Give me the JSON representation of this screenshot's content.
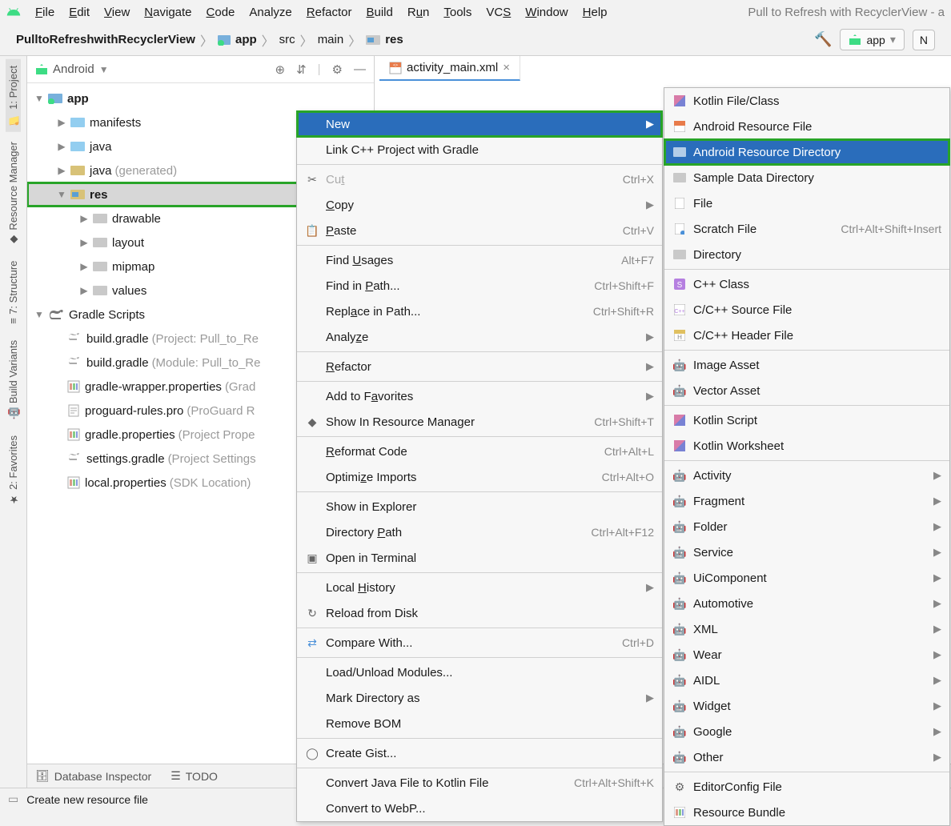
{
  "window": {
    "title_right": "Pull to Refresh with RecyclerView - a"
  },
  "menu": {
    "file": "File",
    "edit": "Edit",
    "view": "View",
    "navigate": "Navigate",
    "code": "Code",
    "analyze": "Analyze",
    "refactor": "Refactor",
    "build": "Build",
    "run": "Run",
    "tools": "Tools",
    "vcs": "VCS",
    "window": "Window",
    "help": "Help"
  },
  "breadcrumb": [
    "PulltoRefreshwithRecyclerView",
    "app",
    "src",
    "main",
    "res"
  ],
  "run_config": {
    "app": "app",
    "new": "N"
  },
  "side_tools": {
    "project": "1: Project",
    "resource_manager": "Resource Manager",
    "structure": "7: Structure",
    "build_variants": "Build Variants",
    "favorites": "2: Favorites"
  },
  "project_header": {
    "title": "Android"
  },
  "tree": {
    "app": "app",
    "manifests": "manifests",
    "java": "java",
    "java_gen": "java",
    "java_gen_suffix": " (generated)",
    "res": "res",
    "drawable": "drawable",
    "layout": "layout",
    "mipmap": "mipmap",
    "values": "values",
    "gradle_scripts": "Gradle Scripts",
    "build_gradle_proj": "build.gradle",
    "build_gradle_proj_suffix": " (Project: Pull_to_Re",
    "build_gradle_mod": "build.gradle",
    "build_gradle_mod_suffix": " (Module: Pull_to_Re",
    "gradle_wrapper": "gradle-wrapper.properties",
    "gradle_wrapper_suffix": " (Grad",
    "proguard": "proguard-rules.pro",
    "proguard_suffix": " (ProGuard R",
    "gradle_props": "gradle.properties",
    "gradle_props_suffix": " (Project Prope",
    "settings_gradle": "settings.gradle",
    "settings_gradle_suffix": " (Project Settings",
    "local_props": "local.properties",
    "local_props_suffix": " (SDK Location)"
  },
  "editor": {
    "tab": "activity_main.xml"
  },
  "context_menu": {
    "new": "New",
    "link_cpp": "Link C++ Project with Gradle",
    "cut": "Cut",
    "cut_sc": "Ctrl+X",
    "copy": "Copy",
    "paste": "Paste",
    "paste_sc": "Ctrl+V",
    "find_usages": "Find Usages",
    "find_usages_sc": "Alt+F7",
    "find_in_path": "Find in Path...",
    "find_in_path_sc": "Ctrl+Shift+F",
    "replace_in_path": "Replace in Path...",
    "replace_in_path_sc": "Ctrl+Shift+R",
    "analyze": "Analyze",
    "refactor": "Refactor",
    "add_favorites": "Add to Favorites",
    "show_resource_mgr": "Show In Resource Manager",
    "show_resource_mgr_sc": "Ctrl+Shift+T",
    "reformat": "Reformat Code",
    "reformat_sc": "Ctrl+Alt+L",
    "optimize_imports": "Optimize Imports",
    "optimize_imports_sc": "Ctrl+Alt+O",
    "show_explorer": "Show in Explorer",
    "directory_path": "Directory Path",
    "directory_path_sc": "Ctrl+Alt+F12",
    "open_terminal": "Open in Terminal",
    "local_history": "Local History",
    "reload_disk": "Reload from Disk",
    "compare_with": "Compare With...",
    "compare_with_sc": "Ctrl+D",
    "load_unload": "Load/Unload Modules...",
    "mark_directory": "Mark Directory as",
    "remove_bom": "Remove BOM",
    "create_gist": "Create Gist...",
    "convert_kotlin": "Convert Java File to Kotlin File",
    "convert_kotlin_sc": "Ctrl+Alt+Shift+K",
    "convert_webp": "Convert to WebP..."
  },
  "submenu": {
    "kotlin_file": "Kotlin File/Class",
    "android_res_file": "Android Resource File",
    "android_res_dir": "Android Resource Directory",
    "sample_data_dir": "Sample Data Directory",
    "file": "File",
    "scratch_file": "Scratch File",
    "scratch_file_sc": "Ctrl+Alt+Shift+Insert",
    "directory": "Directory",
    "cpp_class": "C++ Class",
    "cpp_source": "C/C++ Source File",
    "cpp_header": "C/C++ Header File",
    "image_asset": "Image Asset",
    "vector_asset": "Vector Asset",
    "kotlin_script": "Kotlin Script",
    "kotlin_worksheet": "Kotlin Worksheet",
    "activity": "Activity",
    "fragment": "Fragment",
    "folder": "Folder",
    "service": "Service",
    "ui_component": "UiComponent",
    "automotive": "Automotive",
    "xml": "XML",
    "wear": "Wear",
    "aidl": "AIDL",
    "widget": "Widget",
    "google": "Google",
    "other": "Other",
    "editorconfig": "EditorConfig File",
    "resource_bundle": "Resource Bundle"
  },
  "bottom_tools": {
    "db_inspector": "Database Inspector",
    "todo": "TODO"
  },
  "status_bar": "Create new resource file"
}
